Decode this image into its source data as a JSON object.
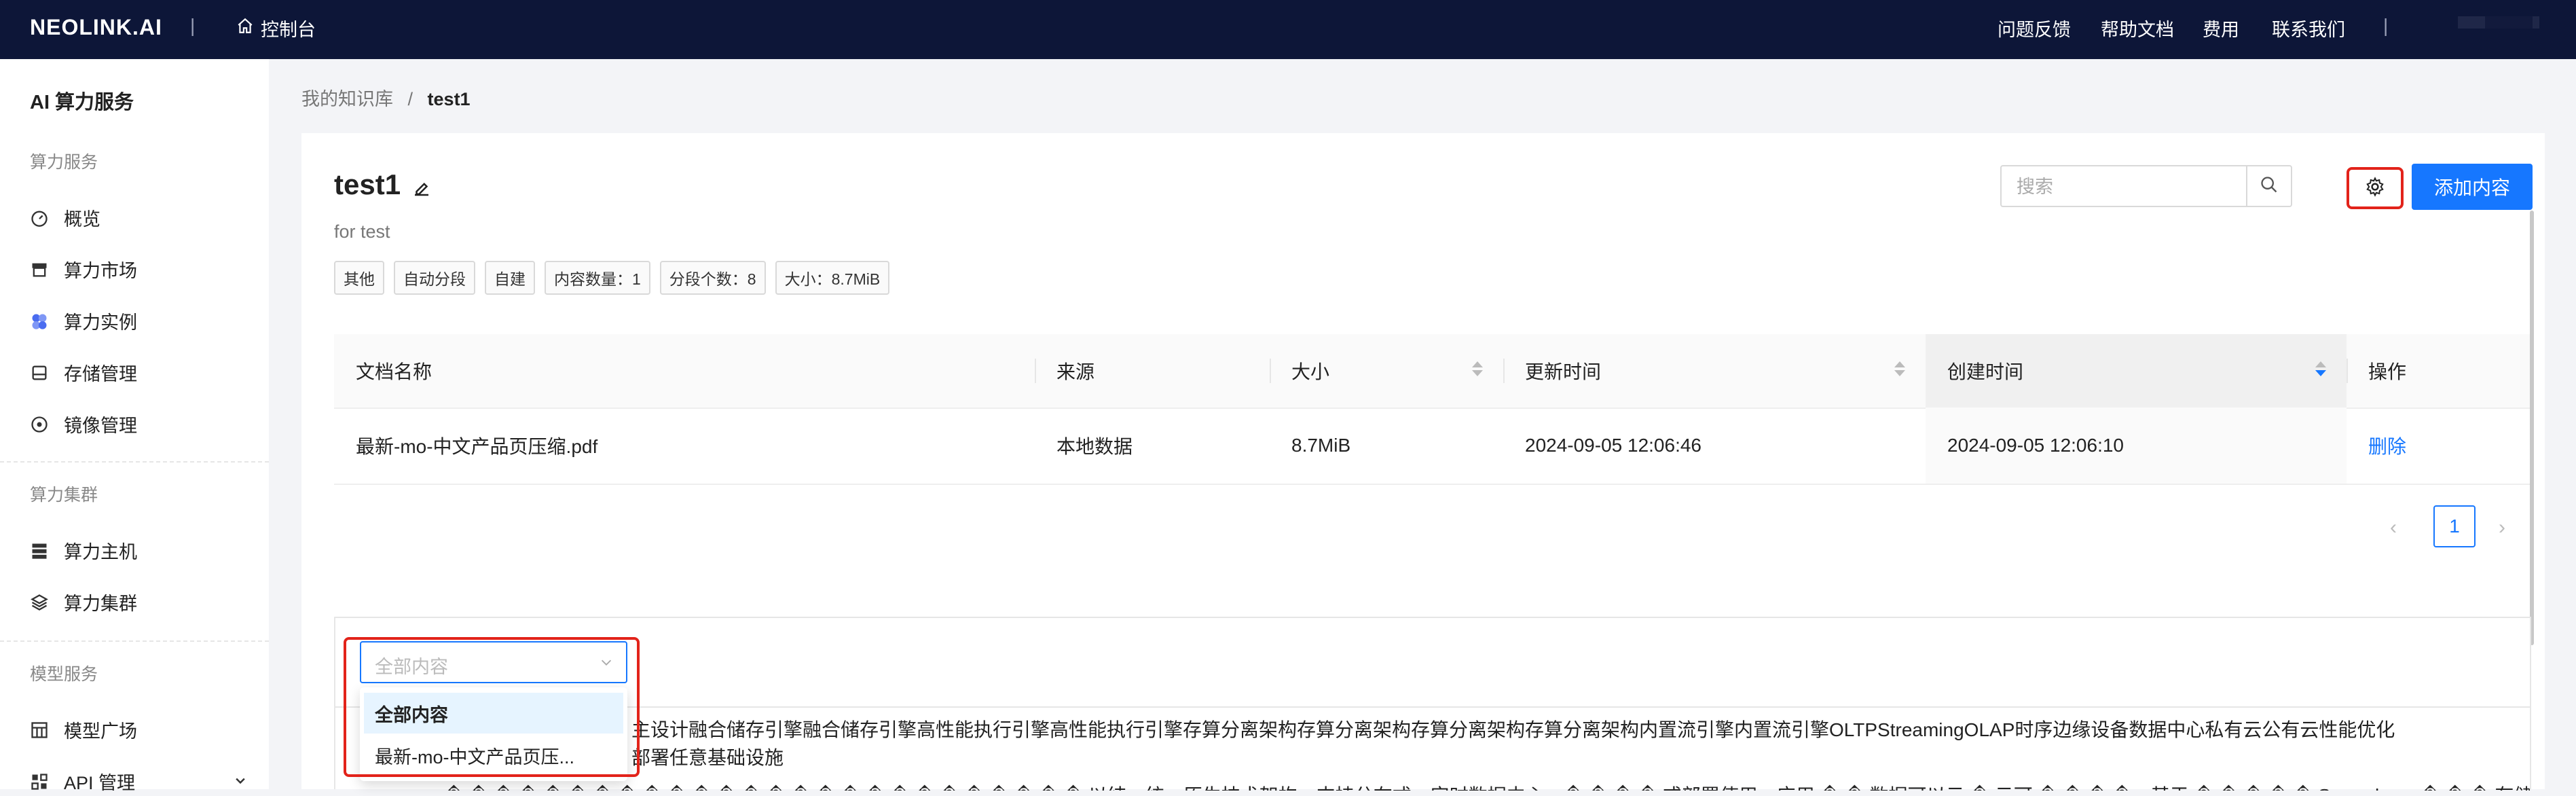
{
  "topbar": {
    "logo": "NEOLINK.AI",
    "separator": "|",
    "console_label": "控制台",
    "links": [
      "问题反馈",
      "帮助文档",
      "费用",
      "联系我们"
    ]
  },
  "sidebar": {
    "title": "AI 算力服务",
    "groups": [
      {
        "label": "算力服务",
        "items": [
          {
            "label": "概览",
            "icon": "dashboard-icon"
          },
          {
            "label": "算力市场",
            "icon": "store-icon"
          },
          {
            "label": "算力实例",
            "icon": "cluster-icon"
          },
          {
            "label": "存储管理",
            "icon": "storage-icon"
          },
          {
            "label": "镜像管理",
            "icon": "image-icon"
          }
        ]
      },
      {
        "label": "算力集群",
        "items": [
          {
            "label": "算力主机",
            "icon": "server-icon"
          },
          {
            "label": "算力集群",
            "icon": "layers-icon"
          }
        ]
      },
      {
        "label": "模型服务",
        "items": [
          {
            "label": "模型广场",
            "icon": "grid-icon"
          },
          {
            "label": "API 管理",
            "icon": "api-icon"
          }
        ]
      }
    ],
    "active_color": "#3a5bd9"
  },
  "breadcrumb": {
    "parent": "我的知识库",
    "separator": "/",
    "current": "test1"
  },
  "kb": {
    "title": "test1",
    "description": "for test",
    "tags": [
      "其他",
      "自动分段",
      "自建",
      "内容数量：1",
      "分段个数：8",
      "大小：8.7MiB"
    ]
  },
  "toolbar": {
    "search_placeholder": "搜索",
    "add_label": "添加内容",
    "accent": "#1677ff",
    "highlight": "#e2231a"
  },
  "table": {
    "columns": [
      "文档名称",
      "来源",
      "大小",
      "更新时间",
      "创建时间",
      "操作"
    ],
    "rows": [
      {
        "name": "最新-mo-中文产品页压缩.pdf",
        "source": "本地数据",
        "size": "8.7MiB",
        "updated": "2024-09-05 12:06:46",
        "created": "2024-09-05 12:06:10",
        "action": "删除"
      }
    ]
  },
  "pagination": {
    "prev": "‹",
    "current": "1",
    "next": "›"
  },
  "viewer": {
    "select_placeholder": "全部内容",
    "options": [
      "全部内容",
      "最新-mo-中文产品页压..."
    ],
    "text_line1": "主设计融合储存引擎融合储存引擎高性能执行引擎高性能执行引擎存算分离架构存算分离架构存算分离架构存算分离架构内置流引擎内置流引擎OLTPStreamingOLAP时序边缘设备数据中心私有云公有云性能优化",
    "text_line2": "部署任意基础设施",
    "text_line3": "� � � � � � � � � � � � � � � � � � � � � � � � � � 以结　统一原生技术架构　支持分布式　实时数据中心　� � � � 或部署使用　应用 � � 数据可以云 � 云可 � � � �　基于 � � � � � Snowsker　� � � 存储　实现有效"
  }
}
